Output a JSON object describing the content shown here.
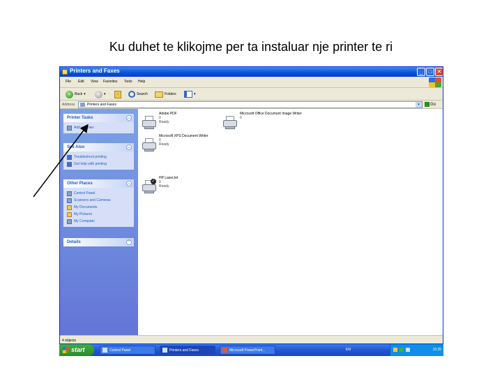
{
  "slide": {
    "title": "Ku duhet te klikojme per ta instaluar nje printer te ri"
  },
  "window": {
    "title": "Printers and Faxes",
    "controls": {
      "minimize": "_",
      "maximize": "□",
      "close": "✕"
    },
    "menu": [
      "File",
      "Edit",
      "View",
      "Favorites",
      "Tools",
      "Help"
    ],
    "toolbar": {
      "back": "Back",
      "search": "Search",
      "folders": "Folders"
    },
    "address": {
      "label": "Address",
      "value": "Printers and Faxes",
      "go": "Go"
    }
  },
  "taskpane": {
    "printer_tasks": {
      "title": "Printer Tasks",
      "items": [
        "Add a printer"
      ]
    },
    "see_also": {
      "title": "See Also",
      "items": [
        "Troubleshoot printing",
        "Get help with printing"
      ]
    },
    "other_places": {
      "title": "Other Places",
      "items": [
        "Control Panel",
        "Scanners and Cameras",
        "My Documents",
        "My Pictures",
        "My Computer"
      ]
    },
    "details": {
      "title": "Details"
    }
  },
  "printers": [
    {
      "name": "Adobe PDF",
      "line2": "0",
      "line3": "Ready",
      "default": false
    },
    {
      "name": "Microsoft XPS Document Writer",
      "line2": "0",
      "line3": "Ready",
      "default": false
    },
    {
      "name": "HP LaserJet",
      "line2": "0",
      "line3": "Ready",
      "default": true
    },
    {
      "name": "Microsoft Office Document Image Writer",
      "line2": "0",
      "line3": "",
      "default": false
    }
  ],
  "statusbar": {
    "text": "4 objects"
  },
  "taskbar": {
    "start": "start",
    "buttons": [
      "Control Panel",
      "Printers and Faxes",
      "Microsoft PowerPoint..."
    ],
    "lang": "EN",
    "clock": "10:35"
  }
}
